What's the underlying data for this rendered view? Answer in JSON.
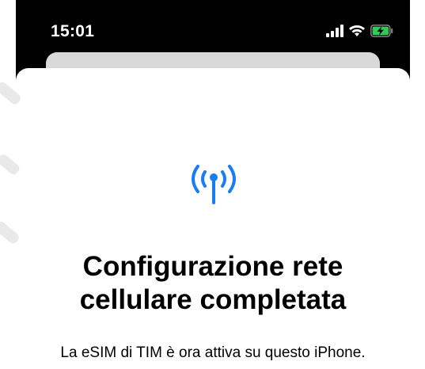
{
  "status_bar": {
    "time": "15:01",
    "icons": [
      "signal-icon",
      "wifi-icon",
      "battery-charging-icon"
    ]
  },
  "main": {
    "icon": "cellular-antenna-icon",
    "title_line1": "Configurazione rete",
    "title_line2": "cellulare completata",
    "subtitle": "La eSIM di TIM è ora attiva su questo iPhone."
  },
  "colors": {
    "accent": "#1a7cf5",
    "battery_charging": "#34c759",
    "sheet_bg": "#ffffff",
    "status_bg": "#000000"
  }
}
